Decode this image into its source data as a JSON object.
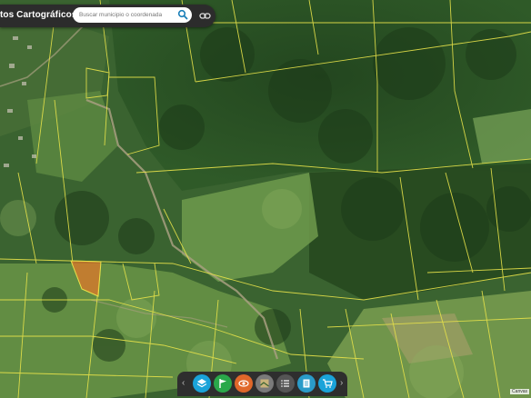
{
  "header": {
    "brand_title": "tos Cartográficos",
    "search_placeholder": "Buscar municipio o coordenada",
    "search_icon": "search-icon",
    "link_icon": "link-icon"
  },
  "map": {
    "imagery": "satellite",
    "parcel_line_color": "#e8e34a",
    "highlight_parcel_color": "#e0782a"
  },
  "toolbar": {
    "prev_label": "‹",
    "next_label": "›",
    "tools": [
      {
        "icon": "layers-icon",
        "color": "#1aa3d9"
      },
      {
        "icon": "flag-icon",
        "color": "#2aa84a"
      },
      {
        "icon": "eye-icon",
        "color": "#e0672a"
      },
      {
        "icon": "basemap-icon",
        "color": "#7a7a7a"
      },
      {
        "icon": "list-icon",
        "color": "#555555"
      },
      {
        "icon": "document-icon",
        "color": "#2a9bc9"
      },
      {
        "icon": "cart-icon",
        "color": "#1aa3d9"
      }
    ]
  },
  "credit": "Canvas"
}
